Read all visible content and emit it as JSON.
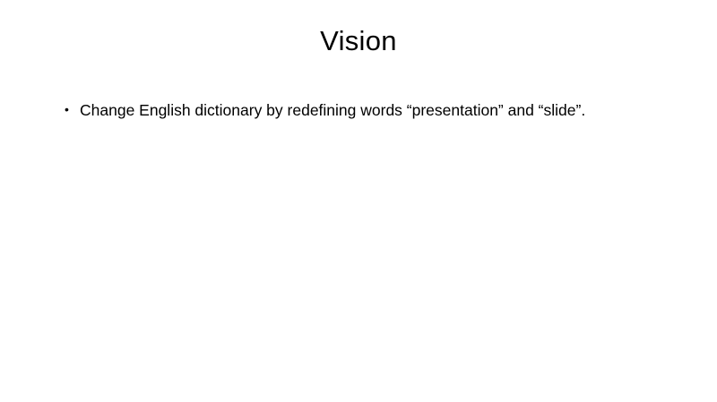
{
  "slide": {
    "title": "Vision",
    "bullets": [
      {
        "marker": "•",
        "text": "Change English dictionary by redefining words “presentation” and “slide”."
      }
    ]
  }
}
